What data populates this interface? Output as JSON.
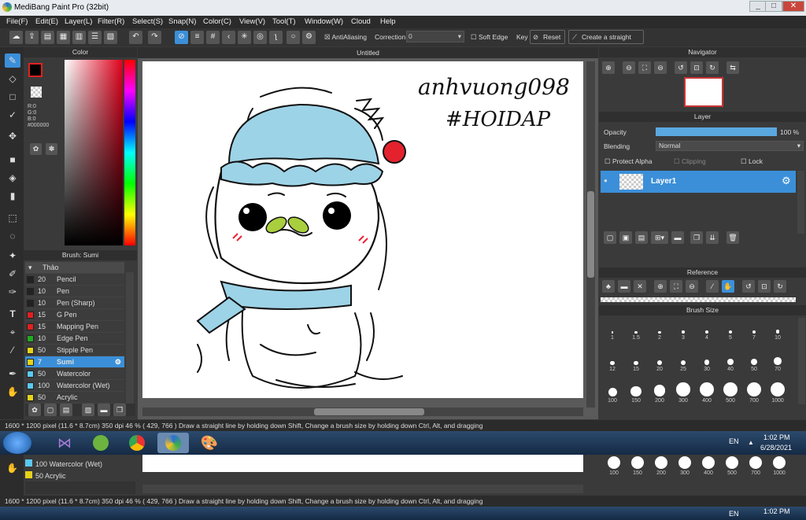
{
  "window": {
    "title": "MediBang Paint Pro (32bit)"
  },
  "menu": [
    "File(F)",
    "Edit(E)",
    "Layer(L)",
    "Filter(R)",
    "Select(S)",
    "Snap(N)",
    "Color(C)",
    "View(V)",
    "Tool(T)",
    "Window(W)",
    "Cloud",
    "Help"
  ],
  "toolbar": {
    "antialiasing": "AntiAliasing",
    "correction_label": "Correction",
    "correction_value": "0",
    "soft_edge": "Soft Edge",
    "key_label": "Key",
    "reset": "Reset",
    "straight_line": "Create a straight line"
  },
  "color_panel": {
    "title": "Color",
    "r": "R:0",
    "g": "G:0",
    "b": "B:0",
    "hex": "#000000"
  },
  "brush_panel": {
    "title": "Brush: Sumi",
    "group": "Thảo",
    "brushes": [
      {
        "size": "20",
        "name": "Pencil",
        "color": "#222222"
      },
      {
        "size": "10",
        "name": "Pen",
        "color": "#222222"
      },
      {
        "size": "10",
        "name": "Pen (Sharp)",
        "color": "#222222"
      },
      {
        "size": "15",
        "name": "G Pen",
        "color": "#e02020"
      },
      {
        "size": "15",
        "name": "Mapping Pen",
        "color": "#e02020"
      },
      {
        "size": "10",
        "name": "Edge Pen",
        "color": "#22aa22"
      },
      {
        "size": "50",
        "name": "Stipple Pen",
        "color": "#e6d21a"
      },
      {
        "size": "7",
        "name": "Sumi",
        "color": "#e6d21a"
      },
      {
        "size": "50",
        "name": "Watercolor",
        "color": "#5bc8f0"
      },
      {
        "size": "100",
        "name": "Watercolor (Wet)",
        "color": "#5bc8f0"
      },
      {
        "size": "50",
        "name": "Acrylic",
        "color": "#e6d21a"
      }
    ]
  },
  "canvas": {
    "tab": "Untitled",
    "handwriting_1": "anhvuong098",
    "handwriting_2": "#HOIDAP"
  },
  "navigator": {
    "title": "Navigator"
  },
  "layer": {
    "title": "Layer",
    "opacity_label": "Opacity",
    "opacity_value": "100 %",
    "opacity_level": 1.0,
    "blending_label": "Blending",
    "blending_value": "Normal",
    "protect_alpha": "Protect Alpha",
    "clipping": "Clipping",
    "lock": "Lock",
    "layer_name": "Layer1"
  },
  "reference": {
    "title": "Reference"
  },
  "brush_size": {
    "title": "Brush Size",
    "sizes": [
      "1",
      "1.5",
      "2",
      "3",
      "4",
      "5",
      "7",
      "10",
      "12",
      "15",
      "20",
      "25",
      "30",
      "40",
      "50",
      "70",
      "100",
      "150",
      "200",
      "300",
      "400",
      "500",
      "700",
      "1000"
    ]
  },
  "status": "1600 * 1200 pixel  (11.6 * 8.7cm)  350 dpi  46 %  ( 429, 766 )  Draw a straight line by holding down Shift, Change a brush size by holding down Ctrl, Alt, and dragging",
  "tray": {
    "lang": "EN",
    "time": "1:02 PM",
    "date": "6/28/2021"
  },
  "ghost": {
    "brush_row_1": "100  Watercolor (Wet)",
    "brush_row_2": "50  Acrylic",
    "sizes": [
      "100",
      "150",
      "200",
      "300",
      "400",
      "500",
      "700",
      "1000"
    ],
    "time": "1:02 PM",
    "lang": "EN"
  }
}
